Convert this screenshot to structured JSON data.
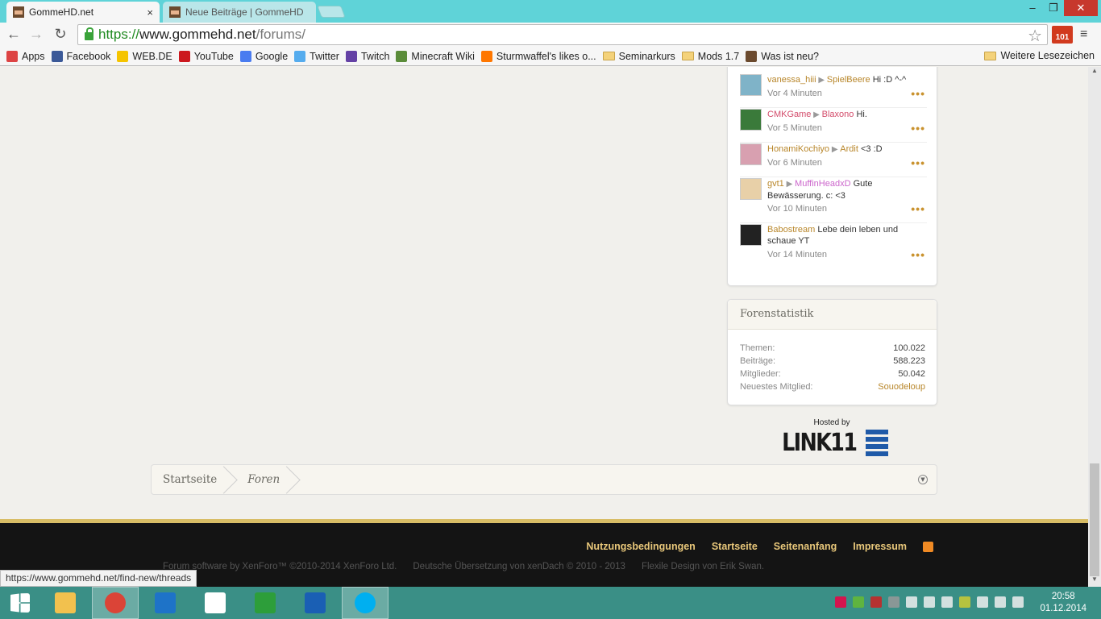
{
  "browser": {
    "tabs": [
      {
        "title": "GommeHD.net",
        "active": true
      },
      {
        "title": "Neue Beiträge | GommeHD",
        "active": false
      }
    ],
    "close_glyph": "×",
    "url": {
      "scheme": "https://",
      "host": "www.gommehd.net",
      "path": "/forums/"
    },
    "extension_badge": "101",
    "bookmarks": [
      {
        "label": "Apps",
        "icon": "apps-grid-icon",
        "color": "#d44"
      },
      {
        "label": "Facebook",
        "icon": "facebook-icon",
        "color": "#3b5998"
      },
      {
        "label": "WEB.DE",
        "icon": "webde-icon",
        "color": "#f5c400"
      },
      {
        "label": "YouTube",
        "icon": "youtube-icon",
        "color": "#cc181e"
      },
      {
        "label": "Google",
        "icon": "google-icon",
        "color": "#4a7cf0"
      },
      {
        "label": "Twitter",
        "icon": "twitter-icon",
        "color": "#55acee"
      },
      {
        "label": "Twitch",
        "icon": "twitch-icon",
        "color": "#6441a5"
      },
      {
        "label": "Minecraft Wiki",
        "icon": "minecraft-icon",
        "color": "#5b8c3a"
      },
      {
        "label": "Sturmwaffel's likes o...",
        "icon": "soundcloud-icon",
        "color": "#f70"
      },
      {
        "label": "Seminarkurs",
        "icon": "folder-icon",
        "color": "#f4d27a"
      },
      {
        "label": "Mods 1.7",
        "icon": "folder-icon",
        "color": "#f4d27a"
      },
      {
        "label": "Was ist neu?",
        "icon": "gommehd-icon",
        "color": "#6b4a2e"
      }
    ],
    "other_bookmarks": "Weitere Lesezeichen"
  },
  "feed": [
    {
      "user": "vanessa_hiii",
      "target": "SpielBeere",
      "text": "Hi :D ^-^",
      "time": "Vor 4 Minuten",
      "user_color": "#b8862a",
      "target_color": "#b8862a",
      "avatar": "#7fb3c8"
    },
    {
      "user": "CMKGame",
      "target": "Blaxono",
      "text": "Hi.",
      "time": "Vor 5 Minuten",
      "user_color": "#d34b6a",
      "target_color": "#d34b6a",
      "avatar": "#3a7a3a"
    },
    {
      "user": "HonamiKochiyo",
      "target": "Ardit",
      "text": "<3 :D",
      "time": "Vor 6 Minuten",
      "user_color": "#b8862a",
      "target_color": "#b8862a",
      "avatar": "#d8a0b0"
    },
    {
      "user": "gvt1",
      "target": "MuffinHeadxD",
      "text": "Gute Bewässerung. c: <3",
      "time": "Vor 10 Minuten",
      "user_color": "#b8862a",
      "target_color": "#cc66cc",
      "avatar": "#e8d0a8"
    },
    {
      "user": "Babostream",
      "target": "",
      "text": "Lebe dein leben und schaue YT",
      "time": "Vor 14 Minuten",
      "user_color": "#b8862a",
      "target_color": "",
      "avatar": "#222"
    }
  ],
  "stats": {
    "title": "Forenstatistik",
    "rows": [
      {
        "label": "Themen:",
        "value": "100.022"
      },
      {
        "label": "Beiträge:",
        "value": "588.223"
      },
      {
        "label": "Mitglieder:",
        "value": "50.042"
      },
      {
        "label": "Neuestes Mitglied:",
        "value": "Souodeloup"
      }
    ]
  },
  "hosted": {
    "label": "Hosted by",
    "logo_text": "LINK11"
  },
  "breadcrumb": {
    "home": "Startseite",
    "current": "Foren"
  },
  "footer": {
    "links": [
      "Nutzungsbedingungen",
      "Startseite",
      "Seitenanfang",
      "Impressum"
    ],
    "copyright": [
      "Forum software by XenForo™ ©2010-2014 XenForo Ltd.",
      "Deutsche Übersetzung von xenDach © 2010 - 2013",
      "Flexile Design von Erik Swan."
    ]
  },
  "status_url": "https://www.gommehd.net/find-new/threads",
  "taskbar": {
    "time": "20:58",
    "date": "01.12.2014",
    "apps": [
      {
        "name": "start",
        "color": "#fff"
      },
      {
        "name": "file-explorer",
        "color": "#f2c14e"
      },
      {
        "name": "chrome",
        "color": "#db4437"
      },
      {
        "name": "maxthon",
        "color": "#1e73c8"
      },
      {
        "name": "home",
        "color": "#fff"
      },
      {
        "name": "store",
        "color": "#2d9e3a"
      },
      {
        "name": "lenovo",
        "color": "#1a5fb4"
      },
      {
        "name": "skype",
        "color": "#00aff0"
      }
    ]
  }
}
